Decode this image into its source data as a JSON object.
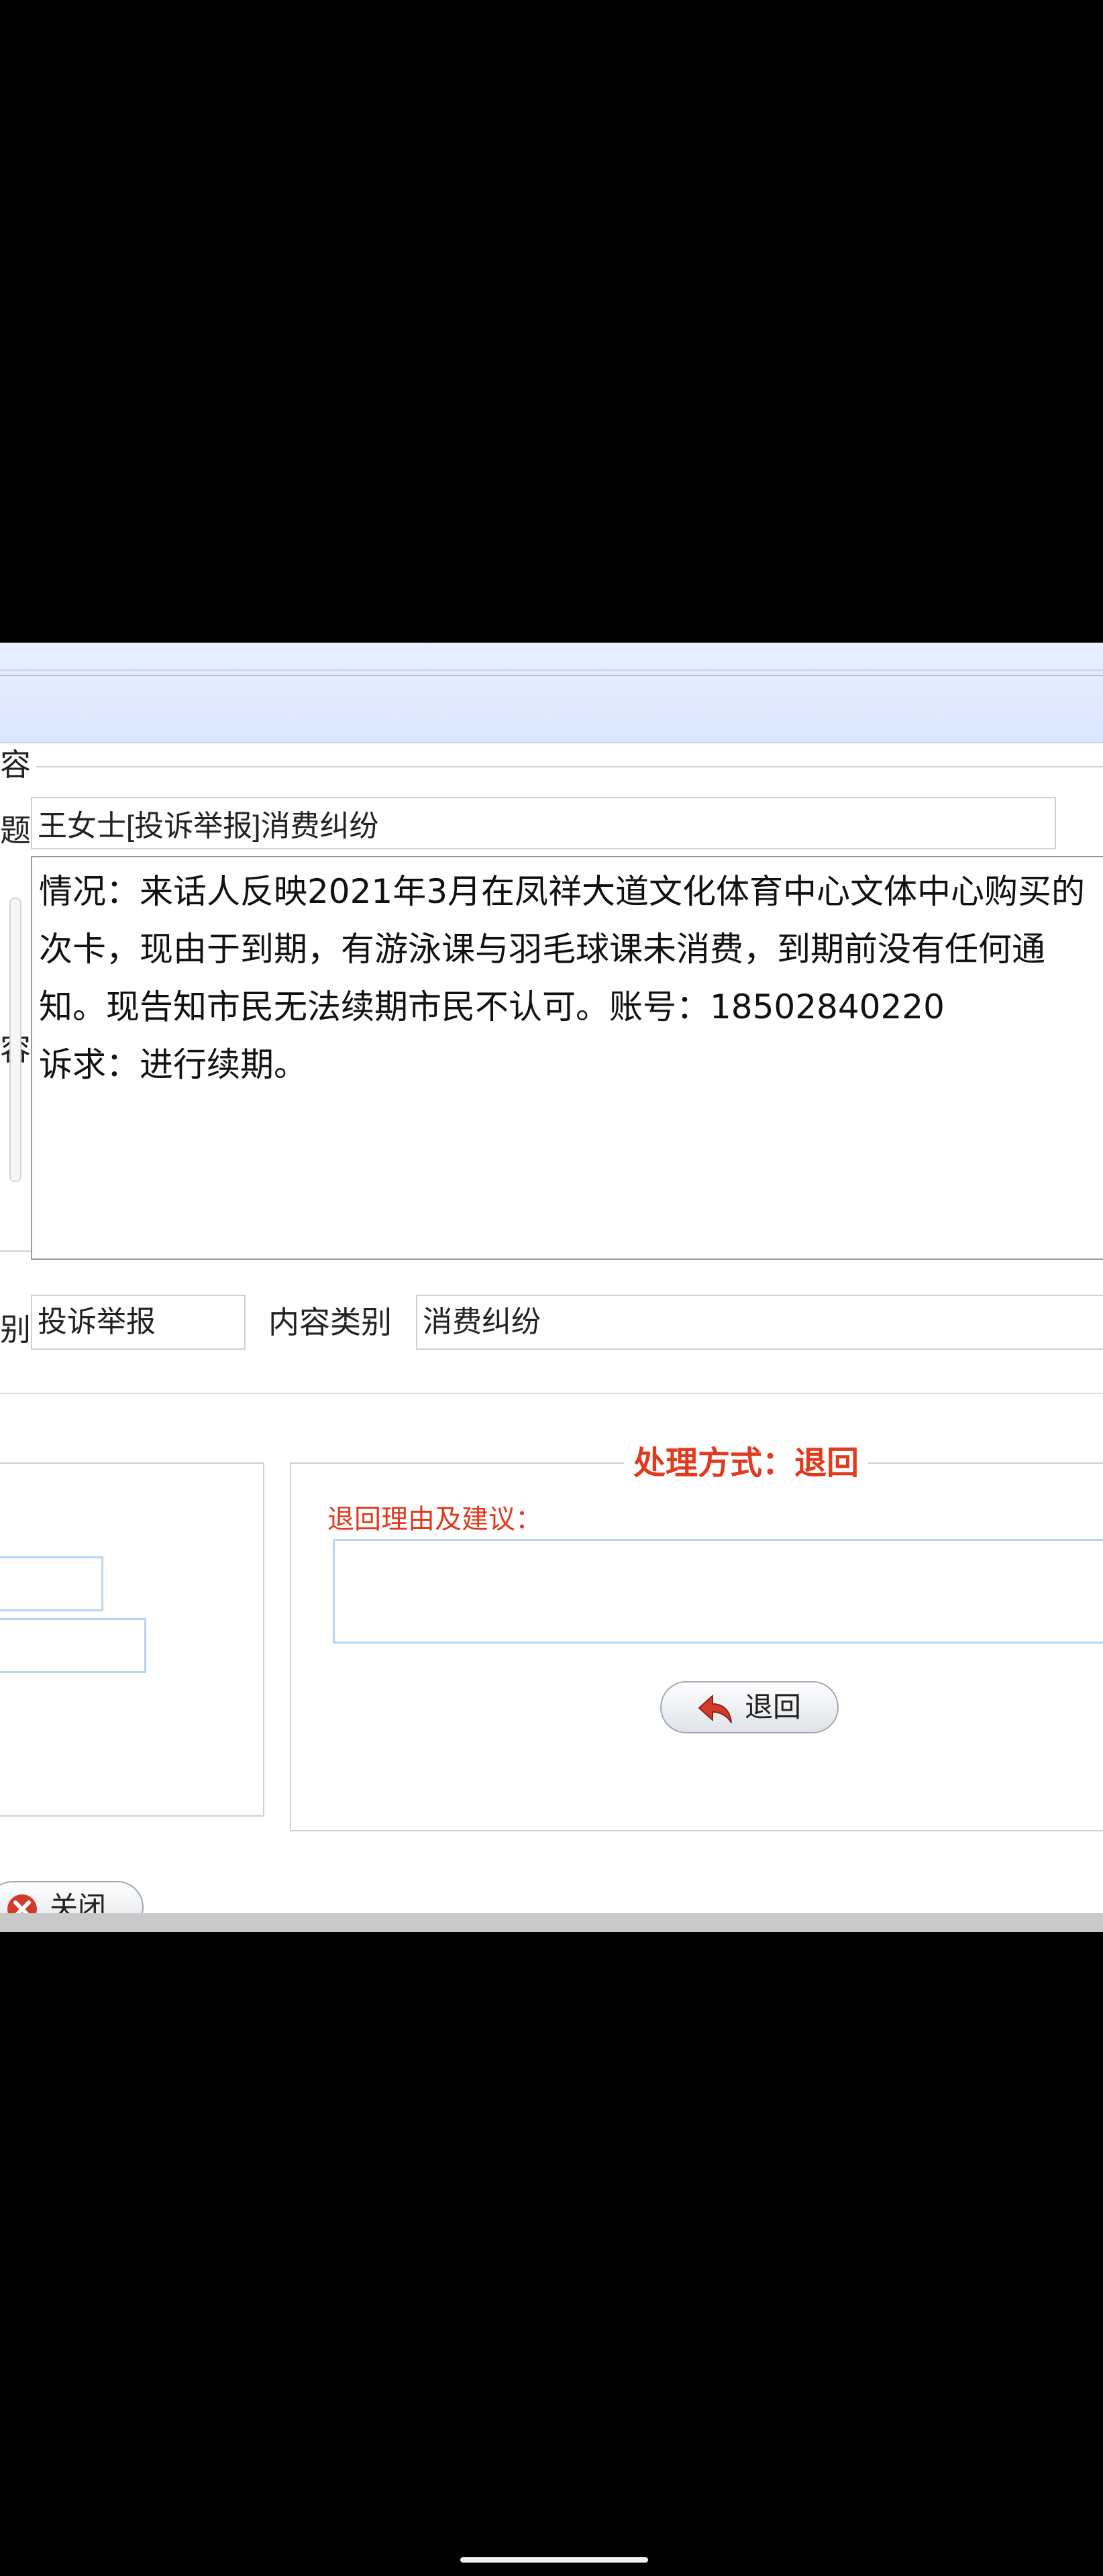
{
  "form": {
    "section_label": "容",
    "title_label": "题",
    "content_label": "容",
    "title_value": "王女士[投诉举报]消费纠纷",
    "content_text": "情况：来话人反映2021年3月在凤祥大道文化体育中心文体中心购买的次卡，现由于到期，有游泳课与羽毛球课未消费，到期前没有任何通知。现告知市民无法续期市民不认可。账号：18502840220\n诉求：进行续期。",
    "category_label": "别",
    "category_value": "投诉举报",
    "content_category_label": "内容类别",
    "content_category_value": "消费纠纷"
  },
  "process": {
    "legend": "处理方式：退回",
    "reason_label": "退回理由及建议：",
    "reason_value": "",
    "return_button": "退回"
  },
  "footer": {
    "close_button": "关闭"
  },
  "icons": {
    "return": "return-arrow-icon",
    "close": "close-x-icon"
  },
  "colors": {
    "accent_red": "#e23a1e",
    "header_blue": "#dbe6ff",
    "input_border_blue": "#b8d4f6"
  }
}
